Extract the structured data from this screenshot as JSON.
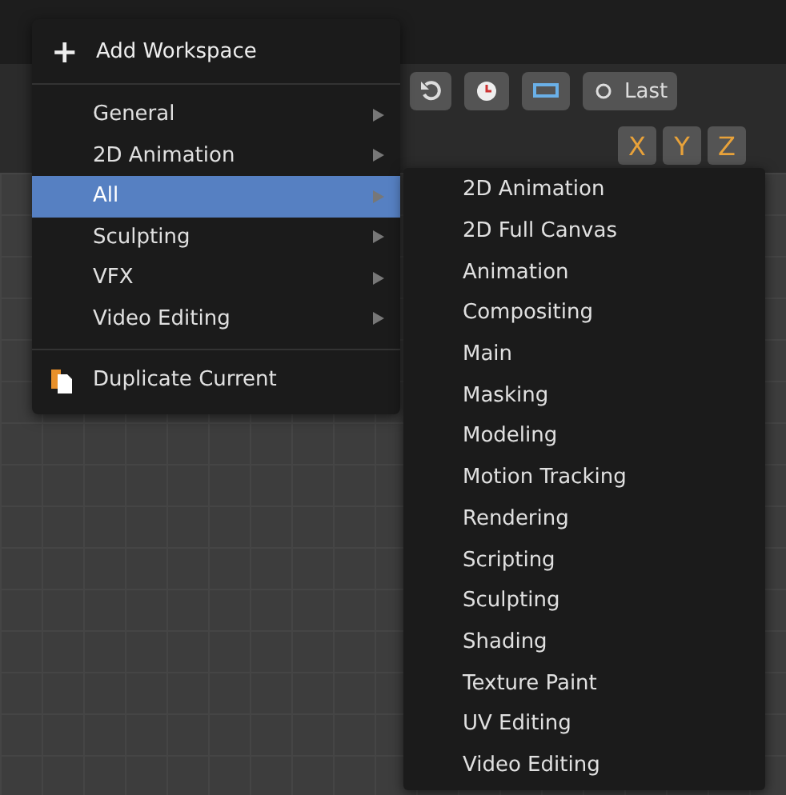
{
  "toolbar": {
    "last_button": "Last",
    "axes": [
      {
        "label": "X"
      },
      {
        "label": "Y"
      },
      {
        "label": "Z"
      }
    ]
  },
  "menu": {
    "add": {
      "icon": "+",
      "label": "Add Workspace"
    },
    "items": [
      {
        "label": "General",
        "selected": false
      },
      {
        "label": "2D Animation",
        "selected": false
      },
      {
        "label": "All",
        "selected": true
      },
      {
        "label": "Sculpting",
        "selected": false
      },
      {
        "label": "VFX",
        "selected": false
      },
      {
        "label": "Video Editing",
        "selected": false
      }
    ],
    "duplicate": "Duplicate Current"
  },
  "submenu": {
    "items": [
      "2D Animation",
      "2D Full Canvas",
      "Animation",
      "Compositing",
      "Main",
      "Masking",
      "Modeling",
      "Motion Tracking",
      "Rendering",
      "Scripting",
      "Sculpting",
      "Shading",
      "Texture Paint",
      "UV Editing",
      "Video Editing"
    ]
  }
}
